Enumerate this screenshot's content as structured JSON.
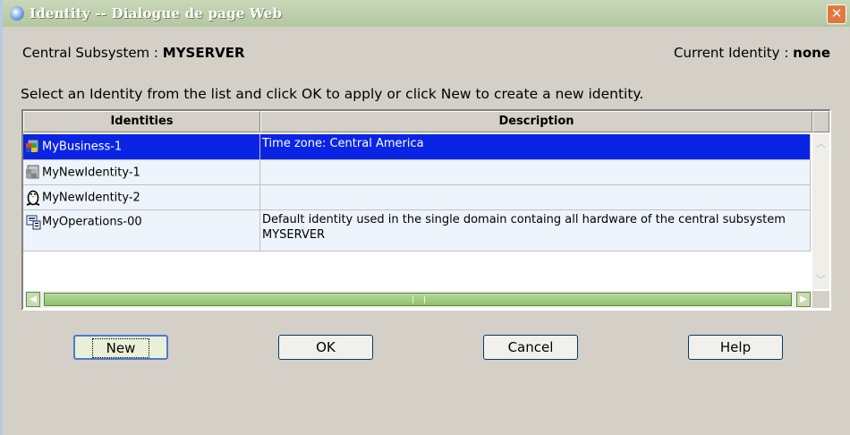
{
  "window": {
    "title": "Identity -- Dialogue de page Web",
    "close": "✕"
  },
  "info": {
    "subsystem_label": "Central Subsystem : ",
    "subsystem_value": "MYSERVER",
    "identity_label": "Current Identity : ",
    "identity_value": "none"
  },
  "instruction": "Select an Identity from the list and click OK to apply or click New to create a new identity.",
  "table": {
    "columns": [
      "Identities",
      "Description"
    ],
    "rows": [
      {
        "name": "MyBusiness-1",
        "description": "Time zone: Central America",
        "icon": "windows-server-icon",
        "selected": true
      },
      {
        "name": "MyNewIdentity-1",
        "description": "",
        "icon": "windows-server-gray-icon"
      },
      {
        "name": "MyNewIdentity-2",
        "description": "",
        "icon": "linux-penguin-icon"
      },
      {
        "name": "MyOperations-00",
        "description": "Default identity used in the single domain containg all hardware of the central subsystem MYSERVER",
        "icon": "operations-icon"
      }
    ]
  },
  "buttons": {
    "new": "New",
    "ok": "OK",
    "cancel": "Cancel",
    "help": "Help"
  },
  "colors": {
    "selection": "#0a24e6",
    "titlebar": "#b3c7a0"
  }
}
